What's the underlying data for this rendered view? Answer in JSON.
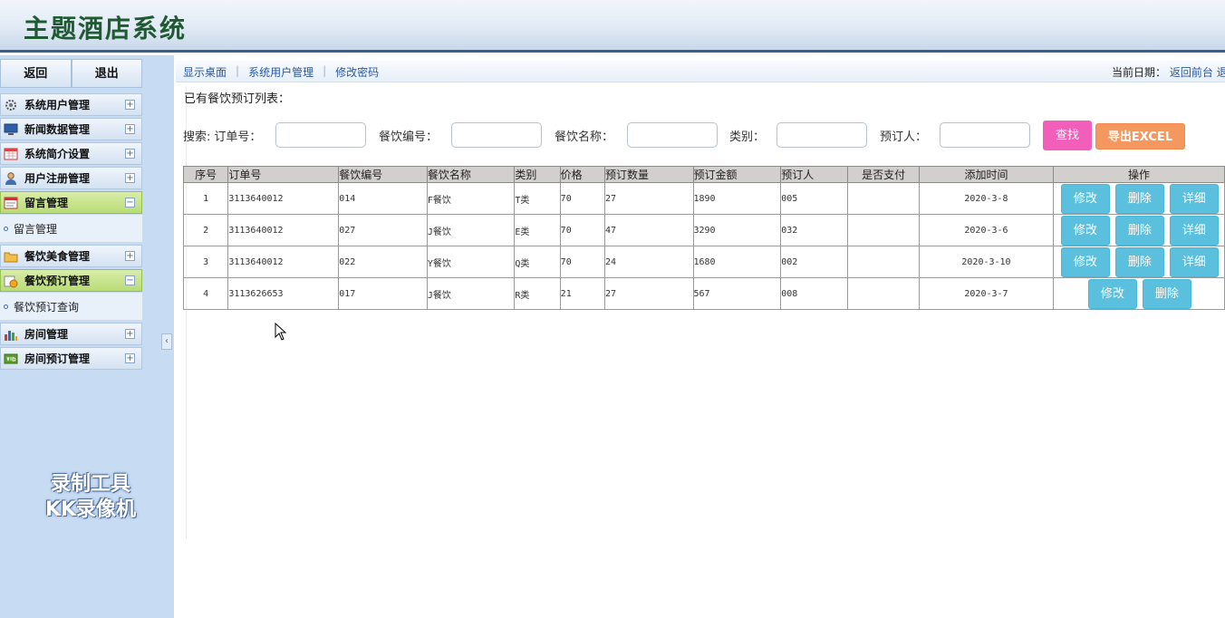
{
  "header": {
    "title": "主题酒店系统"
  },
  "sidebar": {
    "top_buttons": [
      "返回",
      "退出"
    ],
    "items": [
      {
        "label": "系统用户管理",
        "icon": "gear-icon",
        "toggle": "+"
      },
      {
        "label": "新闻数据管理",
        "icon": "monitor-icon",
        "toggle": "+"
      },
      {
        "label": "系统简介设置",
        "icon": "calendar-icon",
        "toggle": "+"
      },
      {
        "label": "用户注册管理",
        "icon": "user-icon",
        "toggle": "+"
      },
      {
        "label": "留言管理",
        "icon": "message-icon",
        "toggle": "−",
        "sub": "留言管理"
      },
      {
        "label": "餐饮美食管理",
        "icon": "folder-icon",
        "toggle": "+"
      },
      {
        "label": "餐饮预订管理",
        "icon": "order-icon",
        "toggle": "−",
        "sub": "餐饮预订查询"
      },
      {
        "label": "房间管理",
        "icon": "chart-icon",
        "toggle": "+"
      },
      {
        "label": "房间预订管理",
        "icon": "vip-icon",
        "toggle": "+"
      }
    ],
    "collapse_arrow": "‹",
    "watermark_line1": "录制工具",
    "watermark_line2": "KK录像机"
  },
  "topnav": {
    "links": [
      "显示桌面",
      "系统用户管理",
      "修改密码"
    ],
    "date_label": "当前日期：",
    "back_link": "返回前台",
    "exit_link": "退"
  },
  "main": {
    "list_title": "已有餐饮预订列表：",
    "search": {
      "prefix": "搜索:",
      "fields": [
        {
          "label": "订单号：",
          "value": ""
        },
        {
          "label": "餐饮编号：",
          "value": ""
        },
        {
          "label": "餐饮名称：",
          "value": ""
        },
        {
          "label": "类别：",
          "value": ""
        },
        {
          "label": "预订人：",
          "value": ""
        }
      ],
      "find_label": "查找",
      "excel_label": "导出EXCEL"
    },
    "table": {
      "headers": [
        "序号",
        "订单号",
        "餐饮编号",
        "餐饮名称",
        "类别",
        "价格",
        "预订数量",
        "预订金额",
        "预订人",
        "是否支付",
        "添加时间",
        "操作"
      ],
      "rows": [
        [
          "1",
          "3113640012",
          "014",
          "F餐饮",
          "T类",
          "70",
          "27",
          "1890",
          "005",
          "",
          "2020-3-8"
        ],
        [
          "2",
          "3113640012",
          "027",
          "J餐饮",
          "E类",
          "70",
          "47",
          "3290",
          "032",
          "",
          "2020-3-6"
        ],
        [
          "3",
          "3113640012",
          "022",
          "Y餐饮",
          "Q类",
          "70",
          "24",
          "1680",
          "002",
          "",
          "2020-3-10"
        ],
        [
          "4",
          "3113626653",
          "017",
          "J餐饮",
          "R类",
          "21",
          "27",
          "567",
          "008",
          "",
          "2020-3-7"
        ]
      ],
      "actions": {
        "edit": "修改",
        "delete": "删除",
        "detail": "详细"
      }
    }
  },
  "colors": {
    "sidebar_bg": "#c7dcf3",
    "active_menu": "#b9dc76",
    "find_button": "#f25fba",
    "excel_button": "#f59860",
    "op_button": "#5bc0de",
    "title_green": "#1f5a32"
  }
}
